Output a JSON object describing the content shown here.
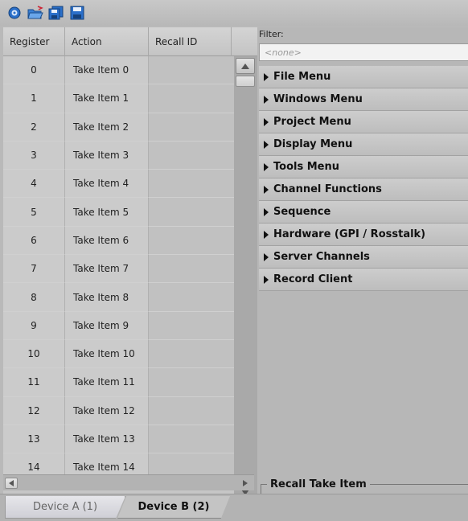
{
  "toolbar": {
    "buttons": [
      {
        "name": "settings-gear-icon"
      },
      {
        "name": "open-folder-icon"
      },
      {
        "name": "save-copy-icon"
      },
      {
        "name": "save-icon"
      }
    ]
  },
  "grid": {
    "columns": [
      "Register",
      "Action",
      "Recall ID"
    ],
    "rows": [
      {
        "register": "0",
        "action": "Take Item 0",
        "recall_id": ""
      },
      {
        "register": "1",
        "action": "Take Item 1",
        "recall_id": ""
      },
      {
        "register": "2",
        "action": "Take Item 2",
        "recall_id": ""
      },
      {
        "register": "3",
        "action": "Take Item 3",
        "recall_id": ""
      },
      {
        "register": "4",
        "action": "Take Item 4",
        "recall_id": ""
      },
      {
        "register": "5",
        "action": "Take Item 5",
        "recall_id": ""
      },
      {
        "register": "6",
        "action": "Take Item 6",
        "recall_id": ""
      },
      {
        "register": "7",
        "action": "Take Item 7",
        "recall_id": ""
      },
      {
        "register": "8",
        "action": "Take Item 8",
        "recall_id": ""
      },
      {
        "register": "9",
        "action": "Take Item 9",
        "recall_id": ""
      },
      {
        "register": "10",
        "action": "Take Item 10",
        "recall_id": ""
      },
      {
        "register": "11",
        "action": "Take Item 11",
        "recall_id": ""
      },
      {
        "register": "12",
        "action": "Take Item 12",
        "recall_id": ""
      },
      {
        "register": "13",
        "action": "Take Item 13",
        "recall_id": ""
      },
      {
        "register": "14",
        "action": "Take Item 14",
        "recall_id": ""
      }
    ]
  },
  "tabs": [
    {
      "label": "Device A (1)",
      "active": false
    },
    {
      "label": "Device B (2)",
      "active": true
    }
  ],
  "right_panel": {
    "filter_label": "Filter:",
    "filter_placeholder": "<none>",
    "menu_items": [
      "File Menu",
      "Windows Menu",
      "Project Menu",
      "Display Menu",
      "Tools Menu",
      "Channel Functions",
      "Sequence",
      "Hardware (GPI / Rosstalk)",
      "Server Channels",
      "Record Client"
    ],
    "group_title": "Recall Take Item"
  }
}
